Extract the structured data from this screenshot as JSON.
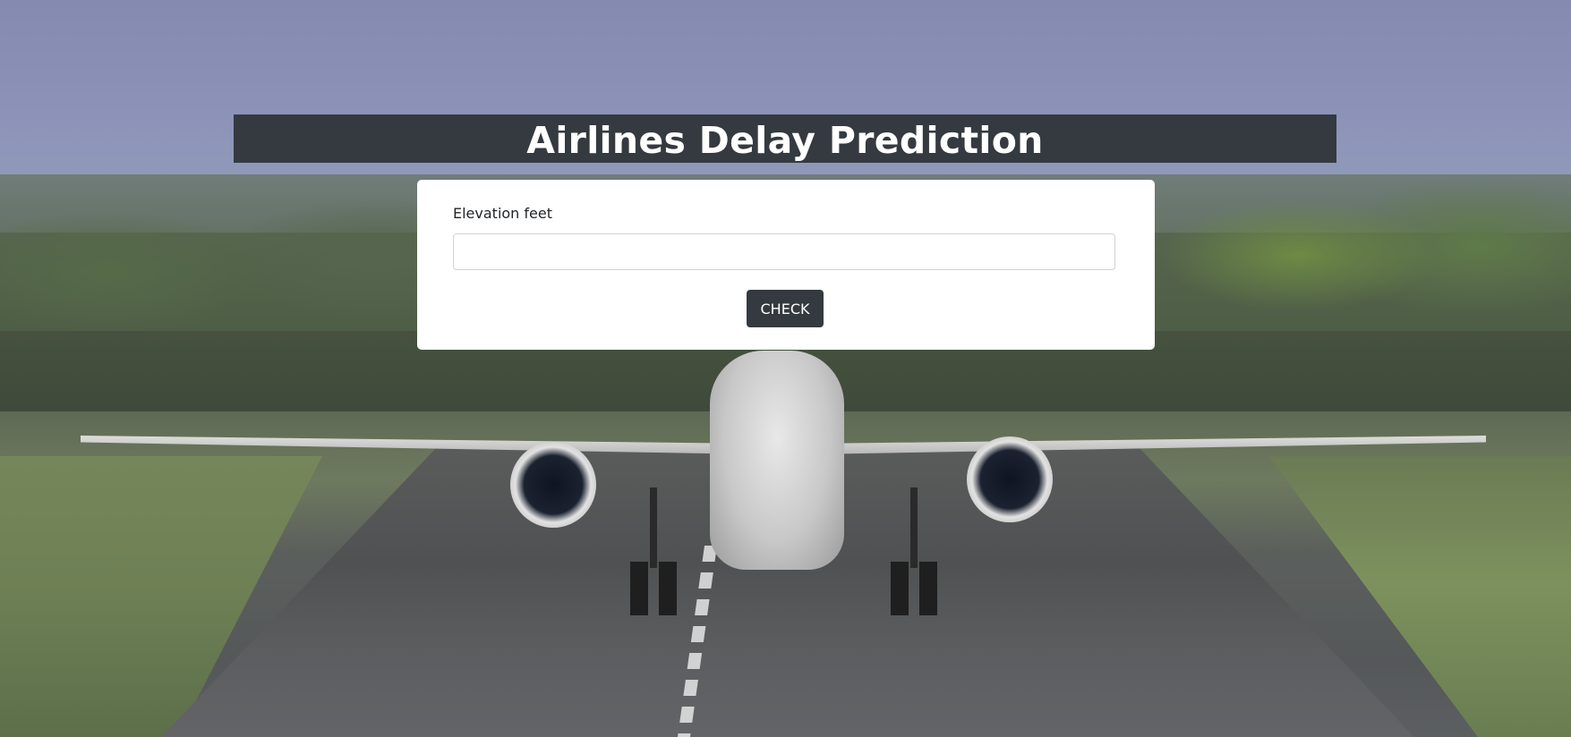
{
  "page": {
    "title": "Airlines Delay Prediction"
  },
  "form": {
    "field_label": "Elevation feet",
    "field_value": "",
    "field_placeholder": "",
    "submit_label": "CHECK"
  },
  "colors": {
    "title_bar_background": "#343a40",
    "title_text": "#ffffff",
    "card_background": "#ffffff",
    "button_background": "#343a40",
    "button_text": "#ffffff"
  },
  "background": {
    "description_icon": "airplane-landing-runway-photo"
  }
}
